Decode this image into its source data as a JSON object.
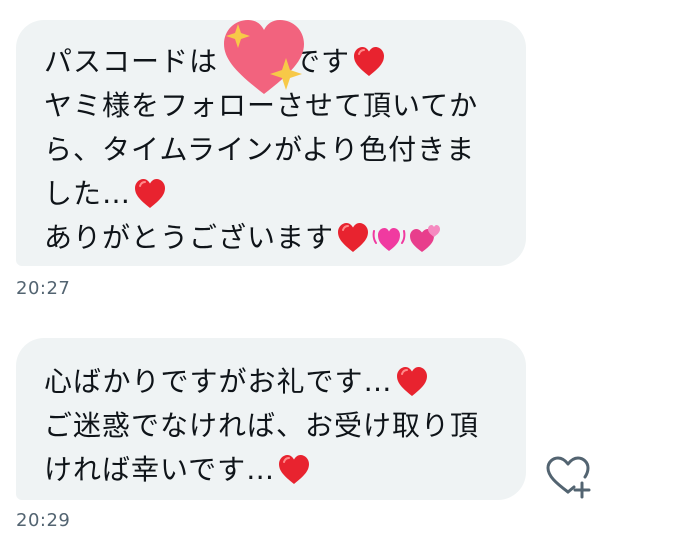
{
  "messages": [
    {
      "lines": [
        {
          "text": "パスコードは",
          "after": "です",
          "hearts": [
            "red-heart"
          ]
        },
        {
          "text": "ヤミ様をフォローさせて頂いてか",
          "hearts": []
        },
        {
          "text": "ら、タイムラインがより色付きま",
          "hearts": []
        },
        {
          "text": "した…",
          "hearts": [
            "red-heart"
          ]
        },
        {
          "text": "ありがとうございます",
          "hearts": [
            "red-heart",
            "beating-heart",
            "revolving-hearts"
          ]
        }
      ],
      "time": "20:27"
    },
    {
      "lines": [
        {
          "text": "心ばかりですがお礼です…",
          "hearts": [
            "red-heart"
          ]
        },
        {
          "text": "ご迷惑でなければ、お受け取り頂",
          "hearts": []
        },
        {
          "text": "ければ幸いです…",
          "hearts": [
            "red-heart"
          ]
        }
      ],
      "time": "20:29"
    }
  ],
  "icons": {
    "sticker": "sparkling-heart-sticker-icon",
    "react": "heart-plus-icon"
  },
  "colors": {
    "bubble": "#eff3f4",
    "timestamp": "#536471",
    "heart": "#e8232f"
  }
}
